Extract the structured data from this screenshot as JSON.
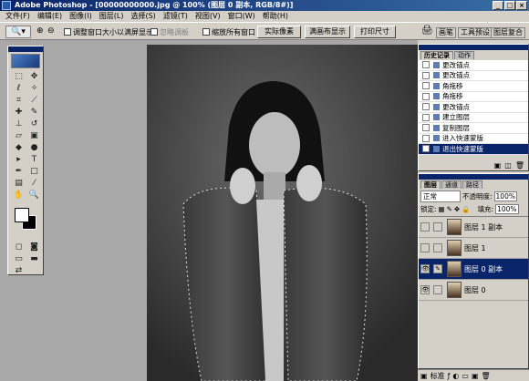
{
  "window": {
    "title": "Adobe Photoshop - [00000000000.jpg @ 100% (图层 0 副本, RGB/8#)]",
    "min": "_",
    "max": "□",
    "close": "×"
  },
  "menu": [
    "文件(F)",
    "编辑(E)",
    "图像(I)",
    "图层(L)",
    "选择(S)",
    "滤镜(T)",
    "视图(V)",
    "窗口(W)",
    "帮助(H)"
  ],
  "options": {
    "check1": "调整窗口大小以满屏显示",
    "check2": "忽略调板",
    "check3": "缩放所有窗口",
    "btn_actual": "实际像素",
    "btn_fit": "满画布显示",
    "btn_print": "打印尺寸",
    "well1": "画笔",
    "well2": "工具预设",
    "well3": "图层复合"
  },
  "history": {
    "tab1": "历史记录",
    "tab2": "动作",
    "items": [
      "更改锚点",
      "更改锚点",
      "角拖移",
      "角拖移",
      "更改锚点",
      "建立图层",
      "复制图层",
      "进入快速蒙版",
      "退出快速蒙版"
    ],
    "selected_index": 8
  },
  "layers": {
    "tab1": "图层",
    "tab2": "通道",
    "tab3": "路径",
    "blend": "正常",
    "opacity_label": "不透明度:",
    "opacity": "100%",
    "lock_label": "锁定:",
    "fill_label": "填充:",
    "fill": "100%",
    "items": [
      {
        "name": "图层 1 副本",
        "selected": false,
        "visible": false
      },
      {
        "name": "图层 1",
        "selected": false,
        "visible": false
      },
      {
        "name": "图层 0 副本",
        "selected": true,
        "visible": true
      },
      {
        "name": "图层 0",
        "selected": false,
        "visible": true
      }
    ]
  },
  "status": {
    "label": "标准",
    "icons": [
      "style-icon",
      "fx-icon",
      "mask-icon",
      "set-icon",
      "new-layer-icon",
      "trash-icon"
    ]
  },
  "colors": {
    "titlebar": "#0a246a",
    "selection": "#0a246a",
    "panel_bg": "#d4d0c8",
    "workspace": "#a8a8a8"
  }
}
